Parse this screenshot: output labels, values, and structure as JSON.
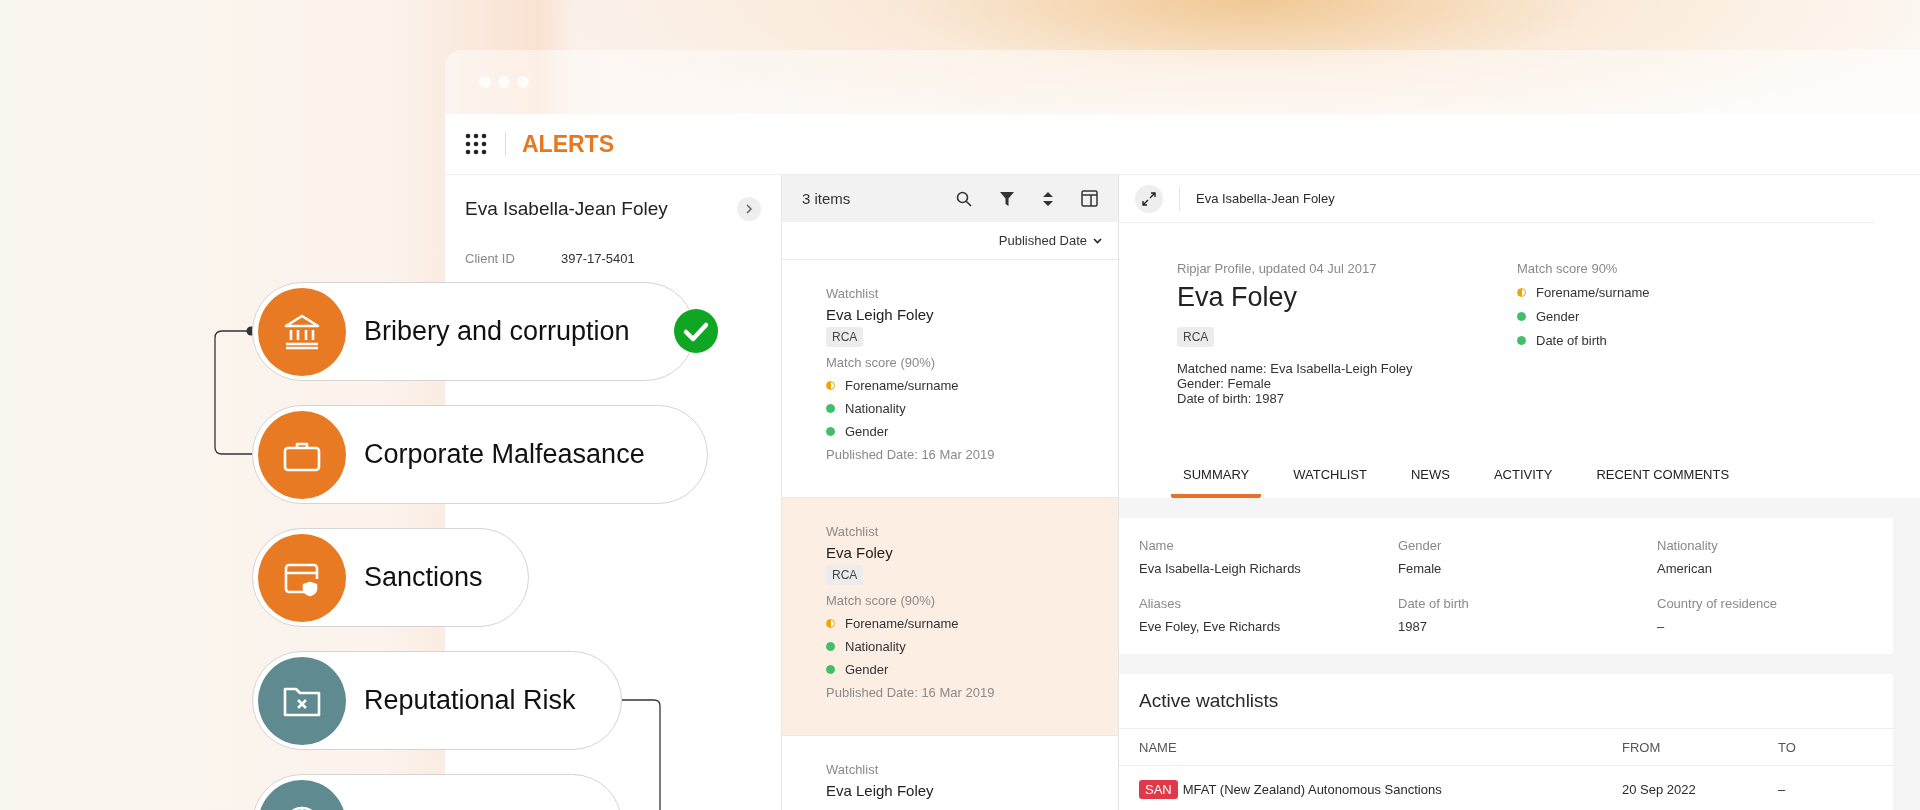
{
  "app": {
    "title": "ALERTS"
  },
  "client": {
    "name": "Eva Isabella-Jean Foley",
    "fields": [
      {
        "label": "Client ID",
        "value": "397-17-5401"
      }
    ]
  },
  "list": {
    "count": "3 items",
    "sort": "Published Date",
    "items": [
      {
        "source": "Watchlist",
        "name": "Eva Leigh Foley",
        "tag": "RCA",
        "score": "Match score (90%)",
        "criteria": [
          {
            "label": "Forename/surname",
            "kind": "partial"
          },
          {
            "label": "Nationality",
            "kind": "full"
          },
          {
            "label": "Gender",
            "kind": "full"
          }
        ],
        "date": "Published Date: 16 Mar 2019",
        "selected": false
      },
      {
        "source": "Watchlist",
        "name": "Eva Foley",
        "tag": "RCA",
        "score": "Match score (90%)",
        "criteria": [
          {
            "label": "Forename/surname",
            "kind": "partial"
          },
          {
            "label": "Nationality",
            "kind": "full"
          },
          {
            "label": "Gender",
            "kind": "full"
          }
        ],
        "date": "Published Date: 16 Mar 2019",
        "selected": true
      },
      {
        "source": "Watchlist",
        "name": "Eva Leigh Foley",
        "selected": false
      }
    ]
  },
  "detail": {
    "header": "Eva Isabella-Jean Foley",
    "profile_source": "Ripjar Profile, updated 04 Jul 2017",
    "name": "Eva Foley",
    "tag": "RCA",
    "matched": [
      "Matched name: Eva Isabella-Leigh Foley",
      "Gender: Female",
      "Date of birth: 1987"
    ],
    "score": "Match score 90%",
    "criteria": [
      {
        "label": "Forename/surname",
        "kind": "partial"
      },
      {
        "label": "Gender",
        "kind": "full"
      },
      {
        "label": "Date of birth",
        "kind": "full"
      }
    ],
    "tabs": [
      {
        "label": "SUMMARY",
        "selected": true
      },
      {
        "label": "WATCHLIST",
        "selected": false
      },
      {
        "label": "NEWS",
        "selected": false
      },
      {
        "label": "ACTIVITY",
        "selected": false
      },
      {
        "label": "RECENT COMMENTS",
        "selected": false
      }
    ],
    "summary": [
      {
        "label": "Name",
        "value": "Eva Isabella-Leigh Richards"
      },
      {
        "label": "Gender",
        "value": "Female"
      },
      {
        "label": "Nationality",
        "value": "American"
      },
      {
        "label": "Aliases",
        "value": "Eve Foley, Eve Richards"
      },
      {
        "label": "Date of birth",
        "value": "1987"
      },
      {
        "label": "Country of residence",
        "value": "–"
      }
    ],
    "watchlists": {
      "title": "Active watchlists",
      "columns": [
        "NAME",
        "FROM",
        "TO"
      ],
      "rows": [
        {
          "badge": "SAN",
          "name": "MFAT (New Zealand) Autonomous Sanctions",
          "from": "20 Sep 2022",
          "to": "–"
        }
      ]
    }
  },
  "categories": [
    {
      "label": "Bribery and corruption",
      "color": "#e87a24",
      "checked": true
    },
    {
      "label": "Corporate Malfeasance",
      "color": "#e87a24",
      "checked": false
    },
    {
      "label": "Sanctions",
      "color": "#e87a24",
      "checked": false
    },
    {
      "label": "Reputational Risk",
      "color": "#5f8a8f",
      "checked": false
    },
    {
      "color": "#5f8a8f",
      "checked": false
    }
  ]
}
